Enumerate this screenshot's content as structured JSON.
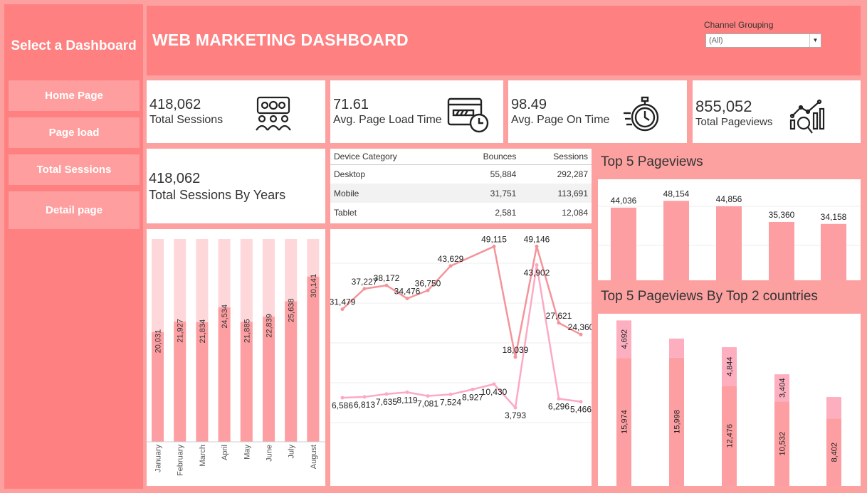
{
  "sidebar": {
    "title": "Select a Dashboard",
    "buttons": [
      "Home Page",
      "Page load",
      "Total Sessions",
      "Detail page"
    ]
  },
  "header": {
    "title": "WEB MARKETING DASHBOARD",
    "filter_label": "Channel Grouping",
    "filter_value": "(All)"
  },
  "kpis": [
    {
      "value": "418,062",
      "label": "Total Sessions",
      "icon": "people-screen-icon"
    },
    {
      "value": "71.61",
      "label": "Avg. Page Load Time",
      "icon": "browser-clock-icon"
    },
    {
      "value": "98.49",
      "label": "Avg. Page On Time",
      "icon": "stopwatch-icon"
    },
    {
      "value": "855,052",
      "label": "Total Pageviews",
      "icon": "analytics-magnifier-icon"
    }
  ],
  "sessions_by_years": {
    "value": "418,062",
    "label": "Total Sessions By Years"
  },
  "device_table": {
    "headers": [
      "Device Category",
      "Bounces",
      "Sessions"
    ],
    "rows": [
      [
        "Desktop",
        "55,884",
        "292,287"
      ],
      [
        "Mobile",
        "31,751",
        "113,691"
      ],
      [
        "Tablet",
        "2,581",
        "12,084"
      ]
    ]
  },
  "top5_title": "Top 5 Pageviews",
  "top5_countries_title": "Top 5 Pageviews By Top 2 countries",
  "colors": {
    "sidebar": "#ff8080",
    "background": "#fca0a0",
    "bar": "#fd9fa2",
    "bar_light": "#fed7da",
    "bar_top": "#fdafc0",
    "line1": "#f4949a",
    "line2": "#fcaac3"
  },
  "chart_data": [
    {
      "type": "bar",
      "categories": [
        "January",
        "February",
        "March",
        "April",
        "May",
        "June",
        "July",
        "August"
      ],
      "values": [
        20031,
        21927,
        21834,
        24534,
        21885,
        22839,
        25638,
        30141
      ],
      "ylim": [
        0,
        37000
      ]
    },
    {
      "type": "line",
      "series": [
        {
          "values": [
            31479,
            37227,
            38172,
            34476,
            36750,
            43629,
            49115,
            18039,
            49146,
            27621,
            24360
          ]
        },
        {
          "values": [
            6586,
            6813,
            7635,
            8119,
            7081,
            7524,
            8927,
            10430,
            3793,
            43902,
            6296,
            5466
          ]
        }
      ]
    },
    {
      "type": "bar",
      "values": [
        44036,
        48154,
        44856,
        35360,
        34158
      ],
      "ylim": [
        0,
        60000
      ]
    },
    {
      "type": "bar",
      "series": [
        {
          "values": [
            15974,
            15998,
            12476,
            10532,
            8402
          ]
        },
        {
          "values": [
            4692,
            null,
            4844,
            3404,
            null
          ]
        }
      ]
    }
  ]
}
